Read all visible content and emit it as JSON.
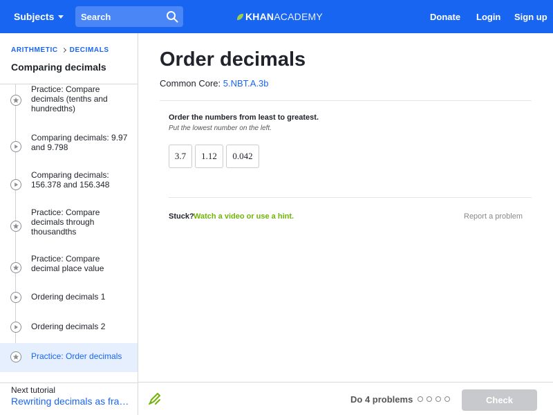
{
  "header": {
    "subjects_label": "Subjects",
    "search_placeholder": "Search",
    "logo_bold": "KHAN",
    "logo_light": "ACADEMY",
    "donate": "Donate",
    "login": "Login",
    "signup": "Sign up",
    "bg_color": "#1865f2"
  },
  "sidebar": {
    "breadcrumb": [
      "ARITHMETIC",
      "DECIMALS"
    ],
    "tutorial_title": "Comparing decimals",
    "items": [
      {
        "label": "Practice: Compare decimals (tenths and hundredths)",
        "icon": "star-icon",
        "active": false
      },
      {
        "label": "Comparing decimals: 9.97 and 9.798",
        "icon": "play-icon",
        "active": false
      },
      {
        "label": "Comparing decimals: 156.378 and 156.348",
        "icon": "play-icon",
        "active": false
      },
      {
        "label": "Practice: Compare decimals through thousandths",
        "icon": "star-icon",
        "active": false
      },
      {
        "label": "Practice: Compare decimal place value",
        "icon": "star-icon",
        "active": false
      },
      {
        "label": "Ordering decimals 1",
        "icon": "play-icon",
        "active": false
      },
      {
        "label": "Ordering decimals 2",
        "icon": "play-icon",
        "active": false
      },
      {
        "label": "Practice: Order decimals",
        "icon": "star-icon",
        "active": true
      }
    ],
    "next_label": "Next tutorial",
    "next_link": "Rewriting decimals as fractions"
  },
  "main": {
    "title": "Order decimals",
    "common_core_label": "Common Core:",
    "common_core_code": "5.NBT.A.3b",
    "instruction": "Order the numbers from least to greatest.",
    "sub_instruction": "Put the lowest number on the left.",
    "cards": [
      "3.7",
      "1.12",
      "0.042"
    ],
    "stuck_label": "Stuck?",
    "stuck_link": "Watch a video or use a hint.",
    "report_label": "Report a problem"
  },
  "footer": {
    "do_label": "Do 4 problems",
    "problem_count": 4,
    "check_label": "Check"
  }
}
